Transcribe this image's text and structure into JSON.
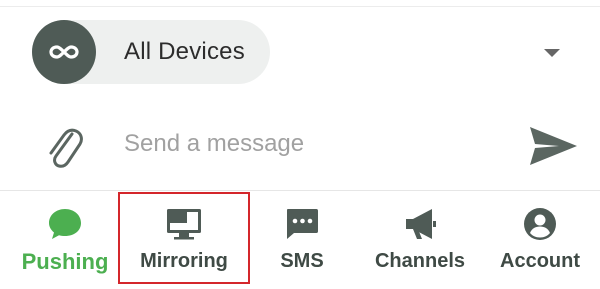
{
  "device_selector": {
    "label": "All Devices",
    "icon": "infinity-icon",
    "dropdown_icon": "caret-down-icon"
  },
  "composer": {
    "attach_icon": "paperclip-icon",
    "placeholder": "Send a message",
    "send_icon": "send-icon"
  },
  "bottom_nav": {
    "items": [
      {
        "label": "Pushing",
        "icon": "chat-bubble-icon",
        "active": true
      },
      {
        "label": "Mirroring",
        "icon": "monitor-icon",
        "highlighted": true
      },
      {
        "label": "SMS",
        "icon": "sms-icon"
      },
      {
        "label": "Channels",
        "icon": "megaphone-icon"
      },
      {
        "label": "Account",
        "icon": "account-circle-icon"
      }
    ]
  },
  "colors": {
    "active": "#4caf50",
    "icon_dark": "#4f5b56",
    "highlight_border": "#d4262b",
    "pill_bg": "#eef0ef"
  }
}
